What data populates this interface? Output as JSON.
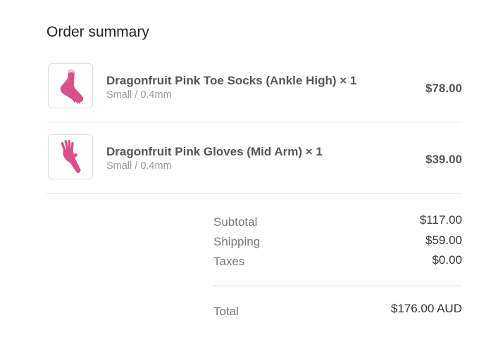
{
  "order_summary": {
    "title": "Order summary",
    "items": [
      {
        "name": "Dragonfruit Pink Toe Socks (Ankle High) × 1",
        "variant": "Small / 0.4mm",
        "price": "$78.00",
        "image_icon": "pink-toe-sock-icon"
      },
      {
        "name": "Dragonfruit Pink Gloves (Mid Arm) × 1",
        "variant": "Small / 0.4mm",
        "price": "$39.00",
        "image_icon": "pink-glove-icon"
      }
    ],
    "totals": {
      "subtotal_label": "Subtotal",
      "subtotal_value": "$117.00",
      "shipping_label": "Shipping",
      "shipping_value": "$59.00",
      "taxes_label": "Taxes",
      "taxes_value": "$0.00",
      "total_label": "Total",
      "total_value": "$176.00 AUD"
    }
  },
  "colors": {
    "product_pink": "#d9508a",
    "text_dark": "#555555",
    "text_muted": "#999999",
    "divider": "#e3e3e3"
  }
}
